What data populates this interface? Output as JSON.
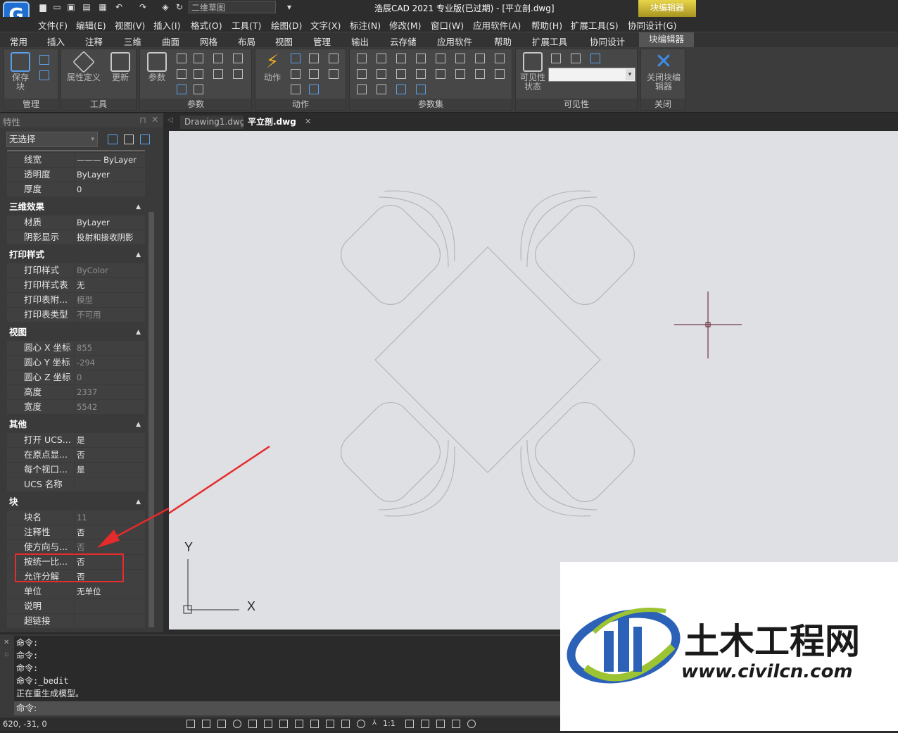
{
  "titlebar": {
    "logo": "G",
    "workspace": "二维草图",
    "title": "浩辰CAD 2021 专业版(已过期) - [平立剖.dwg]",
    "context_tab": "块编辑器"
  },
  "menus": [
    "文件(F)",
    "编辑(E)",
    "视图(V)",
    "插入(I)",
    "格式(O)",
    "工具(T)",
    "绘图(D)",
    "文字(X)",
    "标注(N)",
    "修改(M)",
    "窗口(W)",
    "应用软件(A)",
    "帮助(H)",
    "扩展工具(S)",
    "协同设计(G)"
  ],
  "ribbon_tabs": [
    "常用",
    "插入",
    "注释",
    "三维",
    "曲面",
    "网格",
    "布局",
    "视图",
    "管理",
    "输出",
    "云存储",
    "应用软件",
    "帮助",
    "扩展工具",
    "协同设计",
    "块编辑器"
  ],
  "ribbon": {
    "manage": {
      "title": "管理",
      "save_block": "保存块"
    },
    "tools": {
      "title": "工具",
      "attdef": "属性定义",
      "update": "更新"
    },
    "params": {
      "title": "参数",
      "param": "参数"
    },
    "actions": {
      "title": "动作",
      "action": "动作"
    },
    "paramsets": {
      "title": "参数集"
    },
    "visibility": {
      "title": "可见性",
      "vis_state": "可见性状态"
    },
    "close": {
      "title": "关闭",
      "close_editor": "关闭块编辑器"
    }
  },
  "props": {
    "title": "特性",
    "selection": "无选择",
    "rows_top": [
      {
        "label": "线宽",
        "value": "——— ByLayer"
      },
      {
        "label": "透明度",
        "value": "ByLayer"
      },
      {
        "label": "厚度",
        "value": "0"
      }
    ],
    "sections": {
      "s3d": "三维效果",
      "plot": "打印样式",
      "view": "视图",
      "misc": "其他",
      "block": "块"
    },
    "rows_3d": [
      {
        "label": "材质",
        "value": "ByLayer"
      },
      {
        "label": "阴影显示",
        "value": "投射和接收阴影"
      }
    ],
    "rows_plot": [
      {
        "label": "打印样式",
        "value": "ByColor"
      },
      {
        "label": "打印样式表",
        "value": "无"
      },
      {
        "label": "打印表附...",
        "value": "模型"
      },
      {
        "label": "打印表类型",
        "value": "不可用"
      }
    ],
    "rows_view": [
      {
        "label": "圆心 X 坐标",
        "value": "855"
      },
      {
        "label": "圆心 Y 坐标",
        "value": "-294"
      },
      {
        "label": "圆心 Z 坐标",
        "value": "0"
      },
      {
        "label": "高度",
        "value": "2337"
      },
      {
        "label": "宽度",
        "value": "5542"
      }
    ],
    "rows_misc": [
      {
        "label": "打开 UCS...",
        "value": "是"
      },
      {
        "label": "在原点显...",
        "value": "否"
      },
      {
        "label": "每个视口...",
        "value": "是"
      },
      {
        "label": "UCS 名称",
        "value": ""
      }
    ],
    "rows_block": [
      {
        "label": "块名",
        "value": "11"
      },
      {
        "label": "注释性",
        "value": "否"
      },
      {
        "label": "使方向与...",
        "value": "否"
      },
      {
        "label": "按统一比...",
        "value": "否"
      },
      {
        "label": "允许分解",
        "value": "否"
      },
      {
        "label": "单位",
        "value": "无单位"
      },
      {
        "label": "说明",
        "value": ""
      },
      {
        "label": "超链接",
        "value": ""
      }
    ]
  },
  "doc_tabs": [
    "Drawing1.dwg",
    "平立剖.dwg"
  ],
  "ucs": {
    "x": "X",
    "y": "Y"
  },
  "command": {
    "history": [
      "命令:",
      "命令:",
      "命令:",
      "命令:_bedit",
      "正在重生成模型。"
    ],
    "prompt": "命令:"
  },
  "status": {
    "coords": "620, -31, 0",
    "scale": "1:1"
  },
  "watermark": {
    "name": "土木工程网",
    "url": "www.civilcn.com"
  }
}
